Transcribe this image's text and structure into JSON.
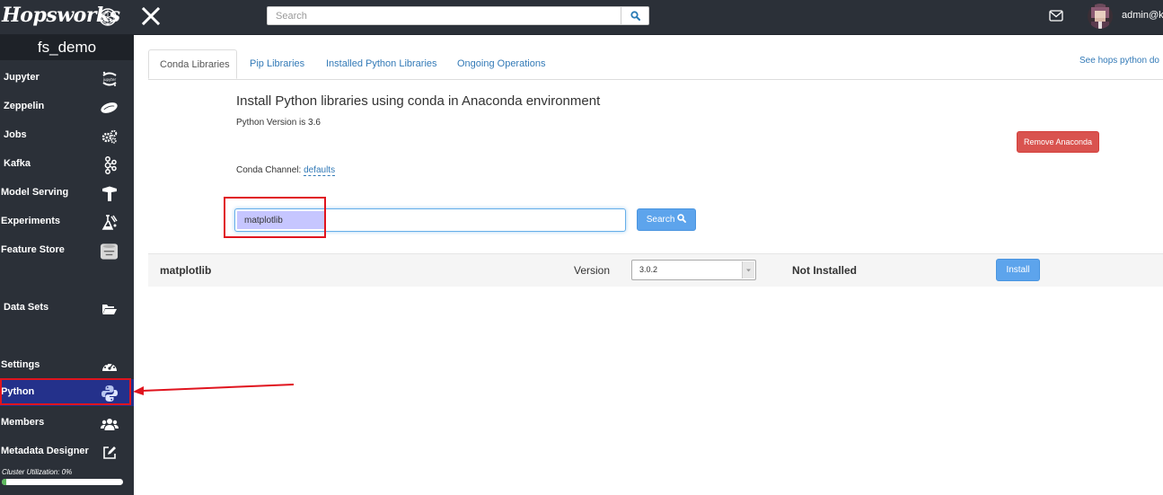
{
  "header": {
    "brand": "Hopsworks",
    "search_placeholder": "Search",
    "user_name": "admin@k"
  },
  "sidebar": {
    "project_name": "fs_demo",
    "items": [
      {
        "label": "Jupyter",
        "icon": "jupyter-icon"
      },
      {
        "label": "Zeppelin",
        "icon": "zeppelin-icon"
      },
      {
        "label": "Jobs",
        "icon": "gears-icon"
      },
      {
        "label": "Kafka",
        "icon": "kafka-icon"
      },
      {
        "label": "Model Serving",
        "icon": "model-serving-icon"
      },
      {
        "label": "Experiments",
        "icon": "experiments-icon"
      },
      {
        "label": "Feature Store",
        "icon": "feature-store-icon"
      },
      {
        "label": "Data Sets",
        "icon": "folder-open-icon"
      },
      {
        "label": "Settings",
        "icon": "dashboard-icon"
      },
      {
        "label": "Python",
        "icon": "python-icon",
        "active": true
      },
      {
        "label": "Members",
        "icon": "users-icon"
      },
      {
        "label": "Metadata Designer",
        "icon": "edit-icon"
      }
    ],
    "cluster_utilization_label": "Cluster Utilization: 0%",
    "cluster_utilization": 0.04
  },
  "main": {
    "tabs": [
      {
        "label": "Conda Libraries",
        "active": true
      },
      {
        "label": "Pip Libraries"
      },
      {
        "label": "Installed Python Libraries"
      },
      {
        "label": "Ongoing Operations"
      }
    ],
    "doc_link": "See hops python do",
    "heading": "Install Python libraries using conda in Anaconda environment",
    "python_version": "Python Version is 3.6",
    "remove_button": "Remove Anaconda",
    "conda_channel_label": "Conda Channel: ",
    "conda_channel_value": "defaults",
    "library_input_value": "matplotlib",
    "search_button": "Search",
    "result": {
      "name": "matplotlib",
      "version_label": "Version",
      "selected_version": "3.0.2",
      "status": "Not Installed",
      "install_button": "Install"
    }
  },
  "colors": {
    "topbar_bg": "#2b3038",
    "sidebar_active": "#24318b",
    "primary_button": "#5da4ec",
    "danger_button": "#d9534f",
    "annotation": "#e0141e"
  }
}
